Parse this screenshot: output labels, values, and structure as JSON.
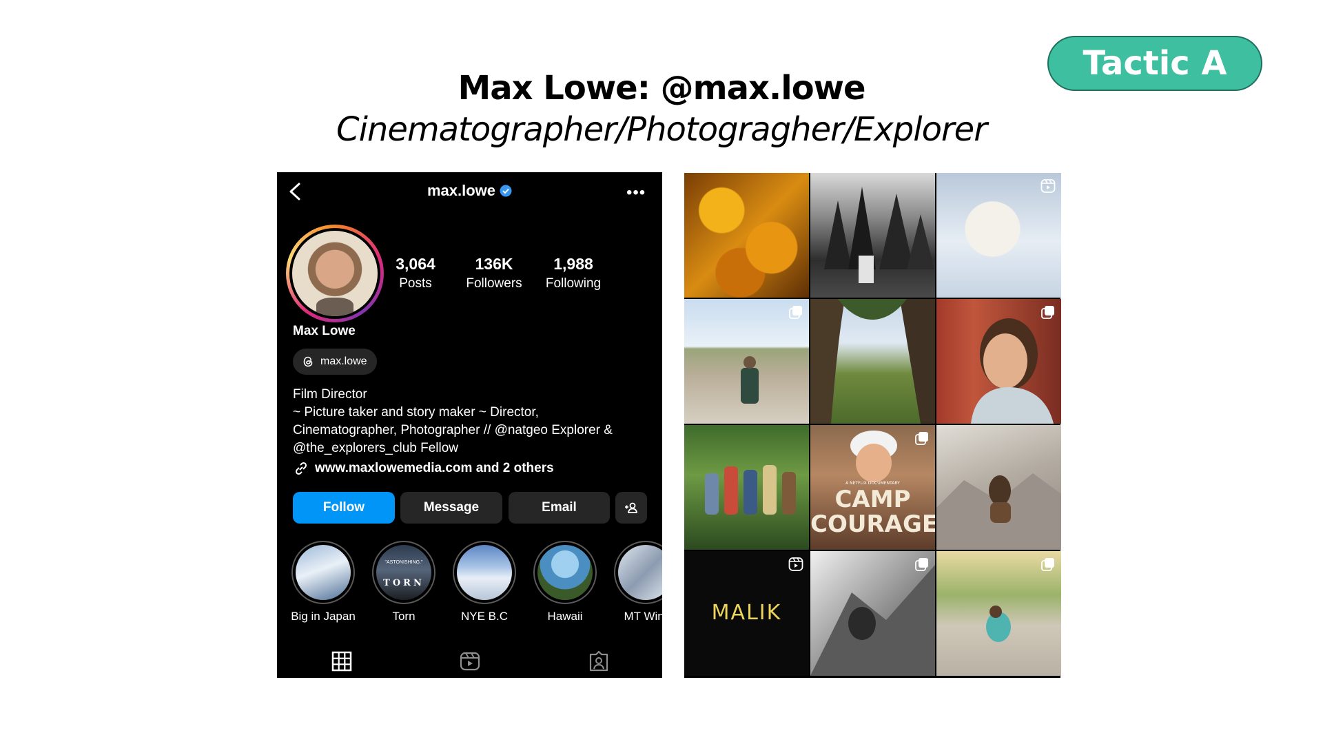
{
  "slide": {
    "badge": "Tactic A",
    "title": "Max Lowe: @max.lowe",
    "subtitle": "Cinematographer/Photogragher/Explorer"
  },
  "profile": {
    "username": "max.lowe",
    "display_name": "Max Lowe",
    "threads_handle": "max.lowe",
    "stats": [
      {
        "value": "3,064",
        "label": "Posts"
      },
      {
        "value": "136K",
        "label": "Followers"
      },
      {
        "value": "1,988",
        "label": "Following"
      }
    ],
    "bio": {
      "category": "Film Director",
      "lines": [
        "~ Picture taker and story maker ~ Director,",
        "Cinematographer, Photographer // @natgeo Explorer &",
        "@the_explorers_club Fellow"
      ]
    },
    "link": "www.maxlowemedia.com and 2 others",
    "buttons": {
      "follow": "Follow",
      "message": "Message",
      "email": "Email"
    },
    "highlights": [
      {
        "label": "Big in Japan"
      },
      {
        "label": "Torn",
        "image_text": "TORN",
        "image_small_text": "\"ASTONISHING.\""
      },
      {
        "label": "NYE B.C"
      },
      {
        "label": "Hawaii"
      },
      {
        "label": "MT Wint"
      }
    ],
    "icons": {
      "back": "back-chevron-icon",
      "verified": "verified-badge-icon",
      "more": "more-options-icon",
      "threads": "threads-icon",
      "link": "link-icon",
      "add_user": "add-user-icon",
      "tabs": [
        "grid-icon",
        "reels-icon",
        "tagged-icon"
      ]
    },
    "colors": {
      "follow_button": "#0095f6",
      "verified": "#3897f0",
      "badge": "#3dbfa0"
    }
  },
  "grid_posts": {
    "camp_courage_kicker": "A NETFLIX DOCUMENTARY",
    "camp_courage_title_1": "CAMP",
    "camp_courage_title_2": "COURAGE",
    "malik_title": "MALIK"
  }
}
